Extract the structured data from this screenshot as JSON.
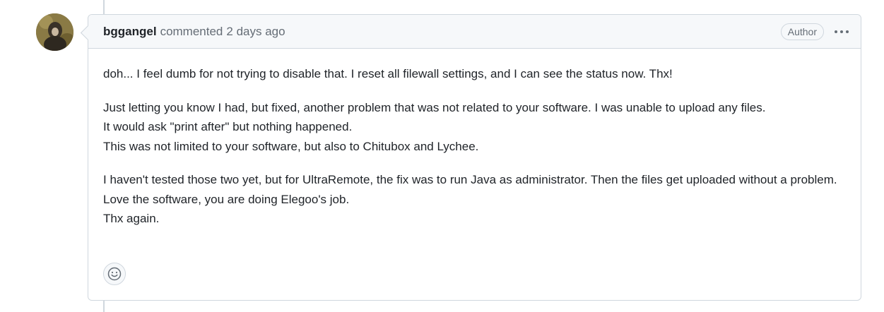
{
  "comment": {
    "author": "bggangel",
    "action_text": "commented",
    "timestamp": "2 days ago",
    "badge": "Author",
    "paragraphs": [
      [
        "doh... I feel dumb for not trying to disable that. I reset all filewall settings, and I can see the status now. Thx!"
      ],
      [
        "Just letting you know I had, but fixed, another problem that was not related to your software. I was unable to upload any files.",
        "It would ask \"print after\" but nothing happened.",
        "This was not limited to your software, but also to Chitubox and Lychee."
      ],
      [
        "I haven't tested those two yet, but for UltraRemote, the fix was to run Java as administrator. Then the files get uploaded without a problem.",
        "Love the software, you are doing Elegoo's job.",
        "Thx again."
      ]
    ]
  },
  "icons": {
    "menu": "kebab-horizontal-icon",
    "reaction": "smiley-icon"
  },
  "colors": {
    "border": "#d0d7de",
    "header_bg": "#f6f8fa",
    "muted_text": "#656d76",
    "text": "#1f2328"
  }
}
